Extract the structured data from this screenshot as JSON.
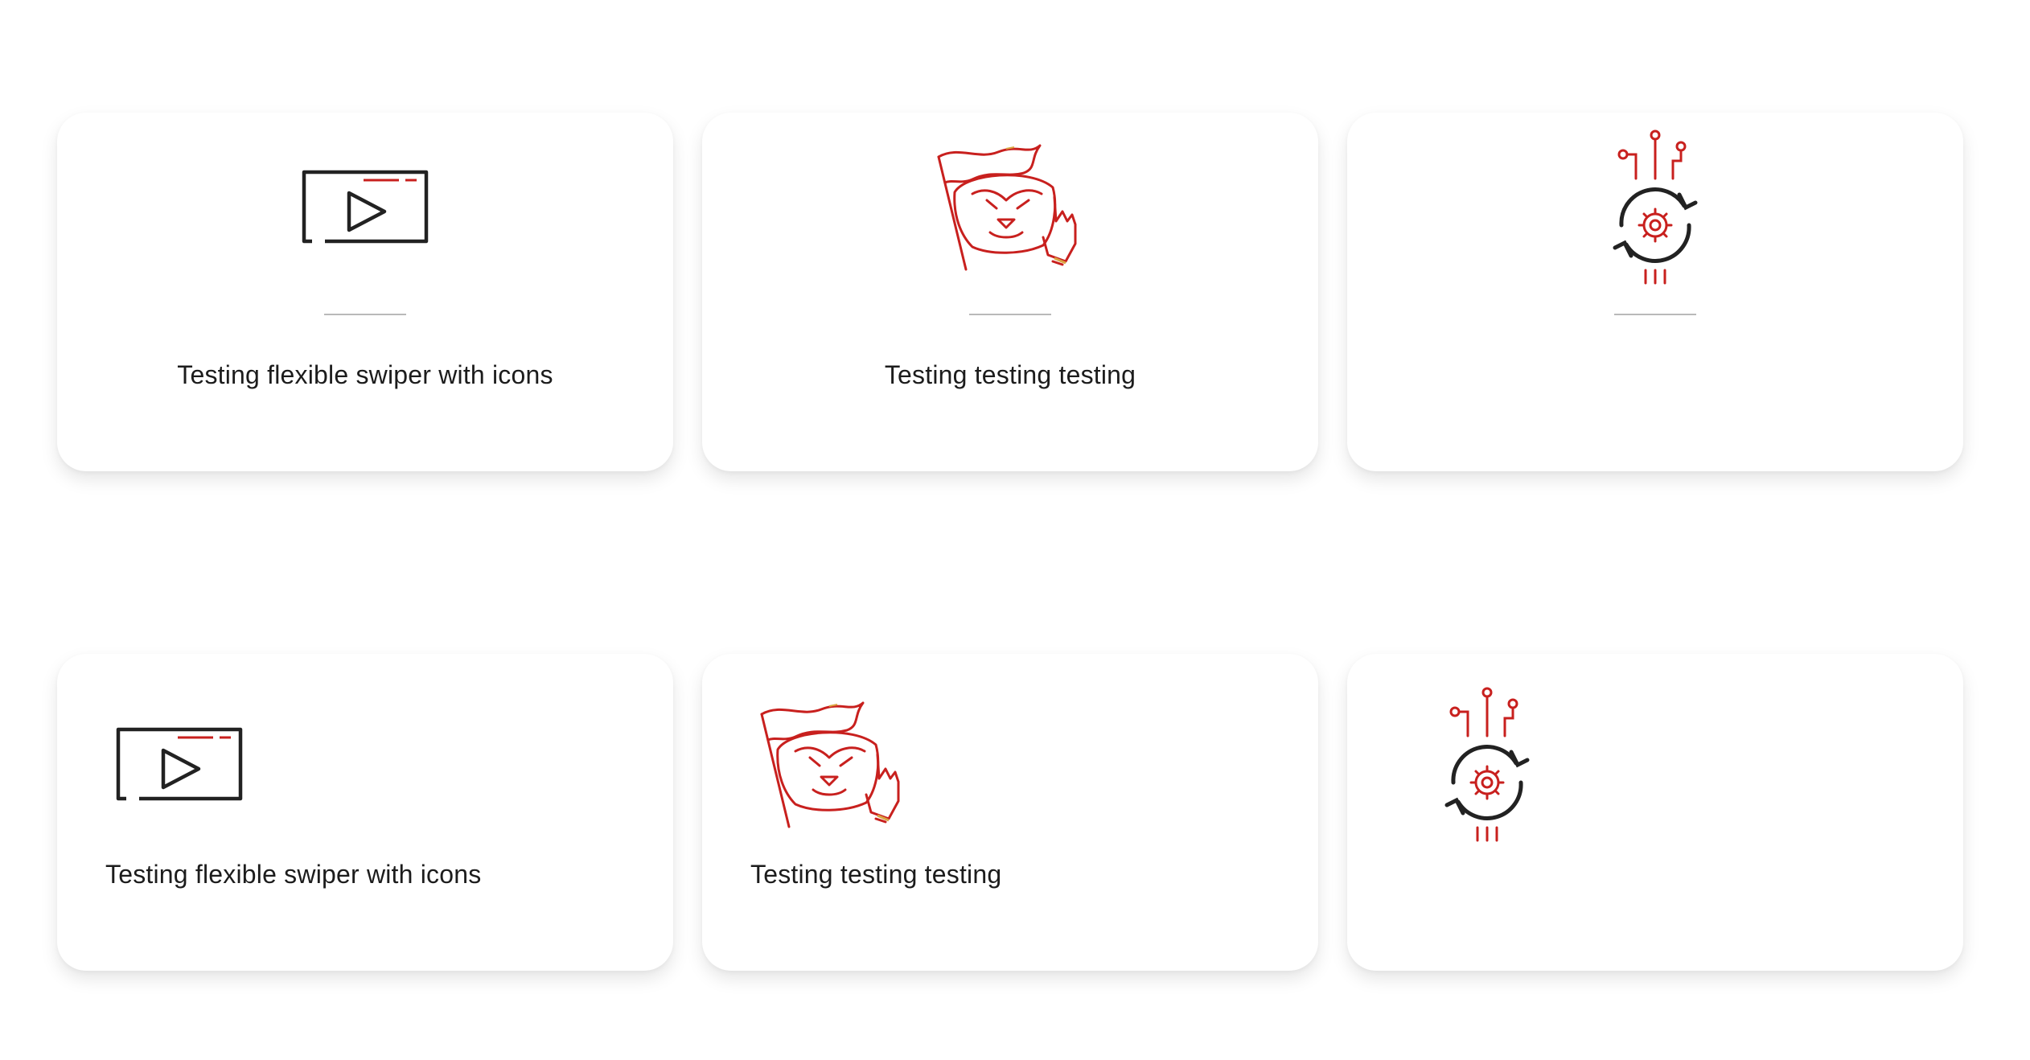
{
  "colors": {
    "accent_red": "#c8201e",
    "accent_gold": "#d9a441",
    "icon_dark": "#222222",
    "divider": "#b9b9b9",
    "text": "#1c1c1c"
  },
  "centered_row": {
    "cards": [
      {
        "icon": "video-play-icon",
        "label": "Testing flexible swiper with icons"
      },
      {
        "icon": "badger-flag-icon",
        "label": "Testing testing testing"
      },
      {
        "icon": "gear-cycle-circuit-icon",
        "label": ""
      }
    ]
  },
  "left_row": {
    "cards": [
      {
        "icon": "video-play-icon",
        "label": "Testing flexible swiper with icons"
      },
      {
        "icon": "badger-flag-icon",
        "label": "Testing testing testing"
      },
      {
        "icon": "gear-cycle-circuit-icon",
        "label": ""
      }
    ]
  }
}
